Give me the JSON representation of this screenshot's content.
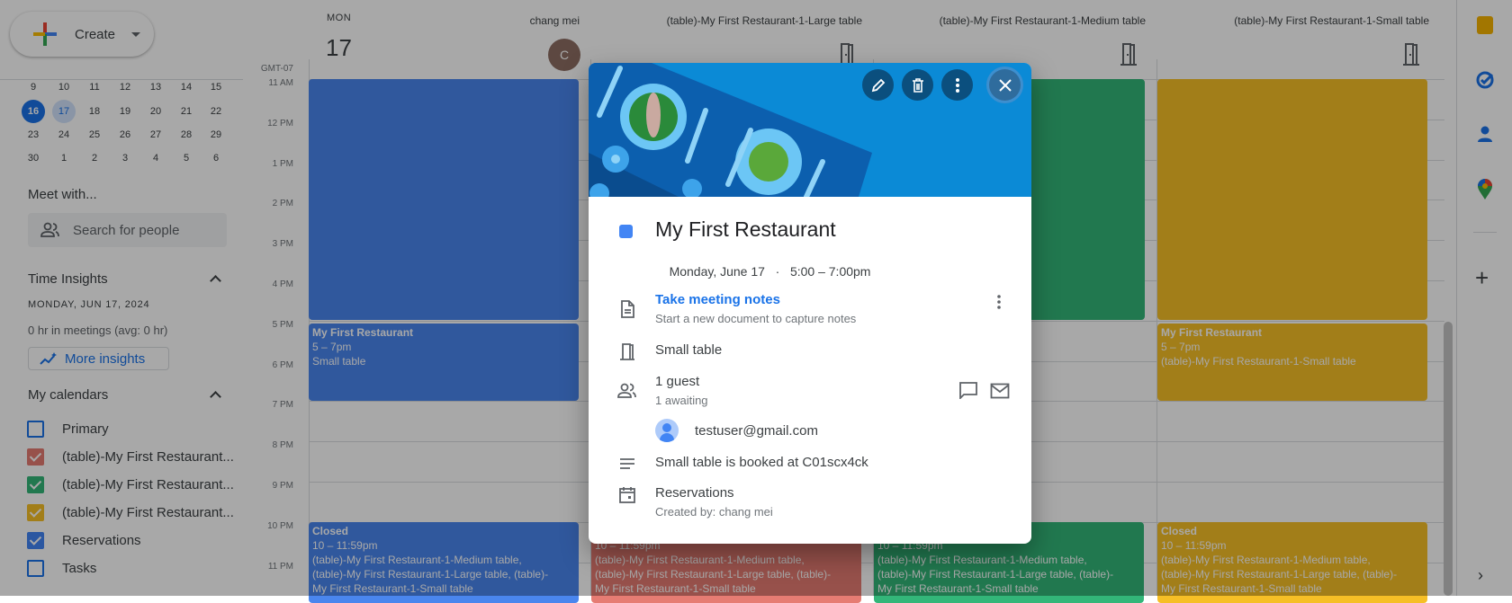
{
  "sidebar": {
    "create_label": "Create",
    "mini_calendar": {
      "rows": [
        [
          "9",
          "10",
          "11",
          "12",
          "13",
          "14",
          "15"
        ],
        [
          "16",
          "17",
          "18",
          "19",
          "20",
          "21",
          "22"
        ],
        [
          "23",
          "24",
          "25",
          "26",
          "27",
          "28",
          "29"
        ],
        [
          "30",
          "1",
          "2",
          "3",
          "4",
          "5",
          "6"
        ]
      ],
      "selected": "16",
      "today": "17"
    },
    "meet_with": {
      "title": "Meet with...",
      "search_placeholder": "Search for people"
    },
    "time_insights": {
      "title": "Time Insights",
      "date": "MONDAY, JUN 17, 2024",
      "summary": "0 hr in meetings (avg: 0 hr)",
      "more_label": "More insights"
    },
    "my_calendars": {
      "title": "My calendars",
      "items": [
        {
          "label": "Primary",
          "checked": false,
          "color": "#1a73e8"
        },
        {
          "label": "(table)-My First Restaurant...",
          "checked": true,
          "color": "#e67c73"
        },
        {
          "label": "(table)-My First Restaurant...",
          "checked": true,
          "color": "#33b679"
        },
        {
          "label": "(table)-My First Restaurant...",
          "checked": true,
          "color": "#f6bf26"
        },
        {
          "label": "Reservations",
          "checked": true,
          "color": "#4285f4"
        },
        {
          "label": "Tasks",
          "checked": false,
          "color": "#1a73e8"
        }
      ]
    }
  },
  "header": {
    "day_name": "MON",
    "day_number": "17",
    "timezone": "GMT-07",
    "columns": [
      {
        "label": "chang mei",
        "avatar_letter": "C"
      },
      {
        "label": "(table)-My First Restaurant-1-Large table",
        "icon": "door-icon"
      },
      {
        "label": "(table)-My First Restaurant-1-Medium table",
        "icon": "door-icon"
      },
      {
        "label": "(table)-My First Restaurant-1-Small table",
        "icon": "door-icon"
      }
    ]
  },
  "time_labels": [
    "11 AM",
    "12 PM",
    "1 PM",
    "2 PM",
    "3 PM",
    "4 PM",
    "5 PM",
    "6 PM",
    "7 PM",
    "8 PM",
    "9 PM",
    "10 PM",
    "11 PM"
  ],
  "events": {
    "col1_reservation": {
      "title": "My First Restaurant",
      "time": "5 – 7pm",
      "location": "Small table"
    },
    "col4_reservation": {
      "title": "My First Restaurant",
      "time": "5 – 7pm",
      "location": "(table)-My First Restaurant-1-Small table"
    },
    "closed": {
      "title": "Closed",
      "time": "10 – 11:59pm",
      "line1": "(table)-My First Restaurant-1-Medium table,",
      "line2": "(table)-My First Restaurant-1-Large table, (table)-",
      "line3": "My First Restaurant-1-Small table"
    },
    "colors": {
      "col1": "#4a86ee",
      "col2": "#e67c73",
      "col3": "#33b679",
      "col4": "#f6bf26"
    }
  },
  "popup": {
    "title": "My First Restaurant",
    "date": "Monday, June 17",
    "separator": "·",
    "time": "5:00 – 7:00pm",
    "color": "#4285f4",
    "notes_link": "Take meeting notes",
    "notes_sub": "Start a new document to capture notes",
    "room": "Small table",
    "guests": "1 guest",
    "guests_status": "1 awaiting",
    "guest_email": "testuser@gmail.com",
    "description": "Small table is booked at C01scx4ck",
    "calendar": "Reservations",
    "created_by": "Created by: chang mei"
  }
}
